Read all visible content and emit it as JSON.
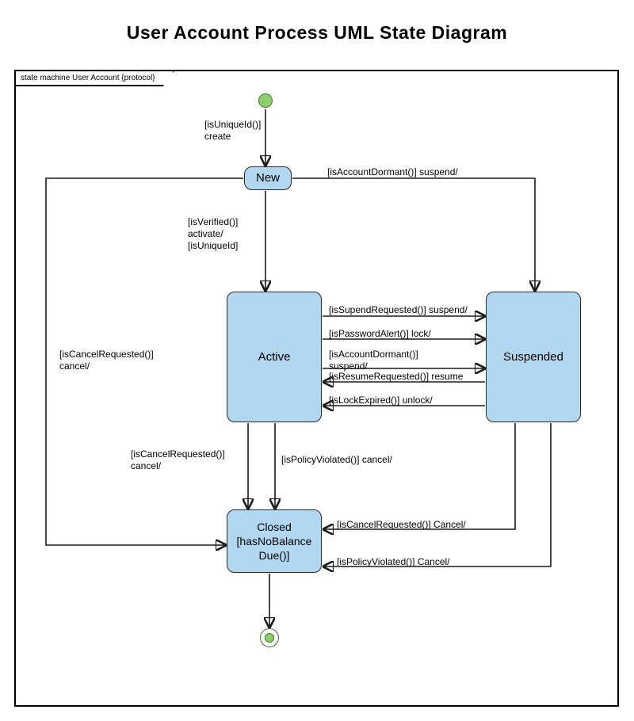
{
  "title": "User Account Process UML State Diagram",
  "frameLabel": "state machine User Account {protocol}",
  "states": {
    "new": "New",
    "active": "Active",
    "suspended": "Suspended",
    "closed": "Closed [hasNoBalance Due()]"
  },
  "transitions": {
    "initialToNew": "[isUniqueId()]\ncreate",
    "newToSuspended": "[isAccountDormant()] suspend/",
    "newToActive": "[isVerified()]\nactivate/\n[isUniqueId]",
    "newToClosed": "[isCancelRequested()]\ncancel/",
    "activeToSuspended1": "[isSupendRequested()] suspend/",
    "activeToSuspended2": "[isPasswordAlert()] lock/",
    "activeToSuspended3": "[isAccountDormant()]\nsuspend/",
    "suspendedToActive1": "[isResumeRequested()] resume",
    "suspendedToActive2": "[isLockExpired()] unlock/",
    "activeToClosed1": "[isCancelRequested()]\ncancel/",
    "activeToClosed2": "[isPolicyViolated()] cancel/",
    "suspendedToClosed1": "[isCancelRequested()] Cancel/",
    "suspendedToClosed2": "[isPolicyViolated()] Cancel/"
  }
}
